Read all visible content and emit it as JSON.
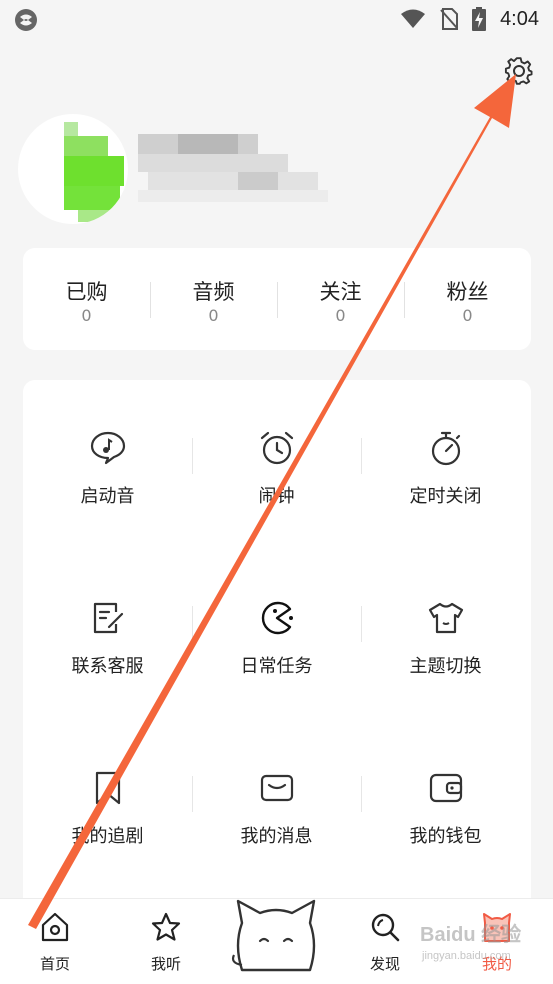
{
  "status_bar": {
    "time": "4:04"
  },
  "stats": [
    {
      "label": "已购",
      "count": "0"
    },
    {
      "label": "音频",
      "count": "0"
    },
    {
      "label": "关注",
      "count": "0"
    },
    {
      "label": "粉丝",
      "count": "0"
    }
  ],
  "grid": [
    {
      "label": "启动音",
      "icon": "chat-music-icon"
    },
    {
      "label": "闹钟",
      "icon": "alarm-clock-icon"
    },
    {
      "label": "定时关闭",
      "icon": "stopwatch-icon"
    },
    {
      "label": "联系客服",
      "icon": "note-edit-icon"
    },
    {
      "label": "日常任务",
      "icon": "pacman-icon"
    },
    {
      "label": "主题切换",
      "icon": "tshirt-icon"
    },
    {
      "label": "我的追剧",
      "icon": "bookmark-icon"
    },
    {
      "label": "我的消息",
      "icon": "envelope-icon"
    },
    {
      "label": "我的钱包",
      "icon": "wallet-icon"
    }
  ],
  "bottom_nav": [
    {
      "label": "首页",
      "icon": "home-icon"
    },
    {
      "label": "我听",
      "icon": "star-icon"
    },
    {
      "label": "发现",
      "icon": "search-icon"
    },
    {
      "label": "我的",
      "icon": "cat-profile-icon"
    }
  ],
  "watermark": {
    "text": "Baidu 经验",
    "sub": "jingyan.baidu.com"
  },
  "colors": {
    "accent": "#f15b45",
    "arrow": "#f4663b",
    "background": "#f5f5f5"
  }
}
